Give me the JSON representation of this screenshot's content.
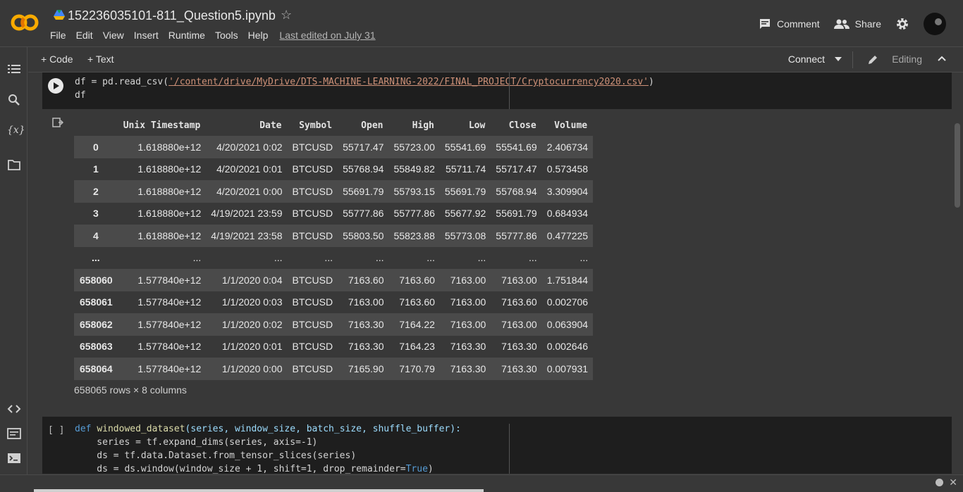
{
  "app": {
    "title": "152236035101-811_Question5.ipynb",
    "last_edited": "Last edited on July 31"
  },
  "menu": [
    "File",
    "Edit",
    "View",
    "Insert",
    "Runtime",
    "Tools",
    "Help"
  ],
  "header": {
    "comment_label": "Comment",
    "share_label": "Share"
  },
  "toolbar": {
    "code_label": "+ Code",
    "text_label": "+ Text",
    "connect_label": "Connect",
    "editing_label": "Editing"
  },
  "cell1": {
    "line1_prefix": "df = pd.read_csv(",
    "line1_str": "'/content/drive/MyDrive/DTS-MACHINE-LEARNING-2022/FINAL_PROJECT/Cryptocurrency2020.csv'",
    "line1_suffix": ")",
    "line2": "df"
  },
  "table": {
    "columns": [
      "",
      "Unix Timestamp",
      "Date",
      "Symbol",
      "Open",
      "High",
      "Low",
      "Close",
      "Volume"
    ],
    "rows": [
      [
        "0",
        "1.618880e+12",
        "4/20/2021 0:02",
        "BTCUSD",
        "55717.47",
        "55723.00",
        "55541.69",
        "55541.69",
        "2.406734"
      ],
      [
        "1",
        "1.618880e+12",
        "4/20/2021 0:01",
        "BTCUSD",
        "55768.94",
        "55849.82",
        "55711.74",
        "55717.47",
        "0.573458"
      ],
      [
        "2",
        "1.618880e+12",
        "4/20/2021 0:00",
        "BTCUSD",
        "55691.79",
        "55793.15",
        "55691.79",
        "55768.94",
        "3.309904"
      ],
      [
        "3",
        "1.618880e+12",
        "4/19/2021 23:59",
        "BTCUSD",
        "55777.86",
        "55777.86",
        "55677.92",
        "55691.79",
        "0.684934"
      ],
      [
        "4",
        "1.618880e+12",
        "4/19/2021 23:58",
        "BTCUSD",
        "55803.50",
        "55823.88",
        "55773.08",
        "55777.86",
        "0.477225"
      ],
      [
        "...",
        "...",
        "...",
        "...",
        "...",
        "...",
        "...",
        "...",
        "..."
      ],
      [
        "658060",
        "1.577840e+12",
        "1/1/2020 0:04",
        "BTCUSD",
        "7163.60",
        "7163.60",
        "7163.00",
        "7163.00",
        "1.751844"
      ],
      [
        "658061",
        "1.577840e+12",
        "1/1/2020 0:03",
        "BTCUSD",
        "7163.00",
        "7163.60",
        "7163.00",
        "7163.60",
        "0.002706"
      ],
      [
        "658062",
        "1.577840e+12",
        "1/1/2020 0:02",
        "BTCUSD",
        "7163.30",
        "7164.22",
        "7163.00",
        "7163.00",
        "0.063904"
      ],
      [
        "658063",
        "1.577840e+12",
        "1/1/2020 0:01",
        "BTCUSD",
        "7163.30",
        "7164.23",
        "7163.30",
        "7163.30",
        "0.002646"
      ],
      [
        "658064",
        "1.577840e+12",
        "1/1/2020 0:00",
        "BTCUSD",
        "7165.90",
        "7170.79",
        "7163.30",
        "7163.30",
        "0.007931"
      ]
    ],
    "shape": "658065 rows × 8 columns"
  },
  "cell2": {
    "bracket": "[ ]",
    "l1_def": "def",
    "l1_fn": "windowed_dataset",
    "l1_args": "(series, window_size, batch_size, shuffle_buffer):",
    "l2": "    series = tf.expand_dims(series, axis=-1)",
    "l3": "    ds = tf.data.Dataset.from_tensor_slices(series)",
    "l4_prefix": "    ds = ds.window(window_size + 1, shift=1, drop_remainder=",
    "l4_true": "True",
    "l4_suffix": ")"
  }
}
